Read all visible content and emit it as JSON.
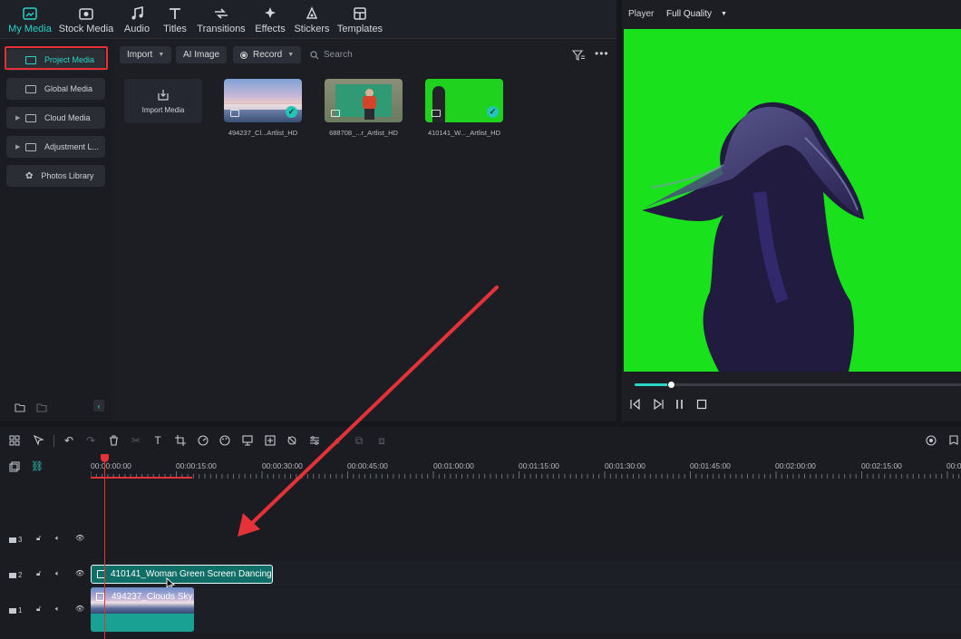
{
  "top_tabs": [
    {
      "label": "My Media",
      "icon": "my-media-icon",
      "active": true
    },
    {
      "label": "Stock Media",
      "icon": "stock-media-icon"
    },
    {
      "label": "Audio",
      "icon": "audio-icon"
    },
    {
      "label": "Titles",
      "icon": "titles-icon"
    },
    {
      "label": "Transitions",
      "icon": "transitions-icon"
    },
    {
      "label": "Effects",
      "icon": "effects-icon"
    },
    {
      "label": "Stickers",
      "icon": "stickers-icon"
    },
    {
      "label": "Templates",
      "icon": "templates-icon"
    }
  ],
  "sidebar": {
    "items": [
      {
        "label": "Project Media",
        "active": true
      },
      {
        "label": "Global Media"
      },
      {
        "label": "Cloud Media",
        "expandable": true
      },
      {
        "label": "Adjustment L...",
        "expandable": true
      },
      {
        "label": "Photos Library"
      }
    ]
  },
  "toolbar": {
    "import_label": "Import",
    "ai_image_label": "AI Image",
    "record_label": "Record",
    "search_placeholder": "Search"
  },
  "media": {
    "import_card_label": "Import Media",
    "items": [
      {
        "label": "494237_Cl...Artlist_HD",
        "checked": true
      },
      {
        "label": "688708_...r_Artlist_HD",
        "checked": false
      },
      {
        "label": "410141_W..._Artlist_HD",
        "checked": true
      }
    ]
  },
  "player": {
    "label": "Player",
    "quality": "Full Quality",
    "progress": 0.11
  },
  "timeline": {
    "ruler": [
      "00:00:00:00",
      "00:00:15:00",
      "00:00:30:00",
      "00:00:45:00",
      "00:01:00:00",
      "00:01:15:00",
      "00:01:30:00",
      "00:01:45:00",
      "00:02:00:00",
      "00:02:15:00",
      "00:0"
    ],
    "tracks": [
      {
        "number": "3"
      },
      {
        "number": "2"
      },
      {
        "number": "1"
      }
    ],
    "clips": {
      "track2": "410141_Woman Green Screen Dancing",
      "track1": "494237_Clouds Sky"
    }
  },
  "colors": {
    "accent": "#2ad4c6",
    "highlight_red": "#e53138",
    "green_screen": "#19e21c"
  }
}
